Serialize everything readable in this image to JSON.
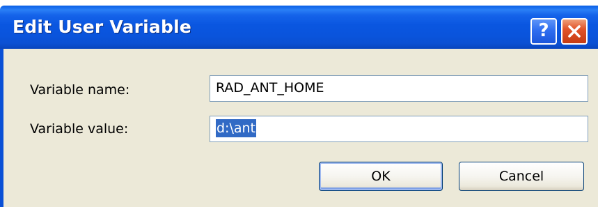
{
  "window": {
    "title": "Edit User Variable",
    "help_glyph": "?",
    "help_icon": "question-mark-icon",
    "close_icon": "close-x-icon"
  },
  "form": {
    "name_label": "Variable name:",
    "name_value": "RAD_ANT_HOME",
    "value_label": "Variable value:",
    "value_value": "d:\\ant"
  },
  "buttons": {
    "ok_label": "OK",
    "cancel_label": "Cancel"
  },
  "colors": {
    "titlebar": "#0a54dc",
    "dialog_bg": "#ece9d8",
    "selection": "#316ac5",
    "close_button": "#e2542a"
  }
}
